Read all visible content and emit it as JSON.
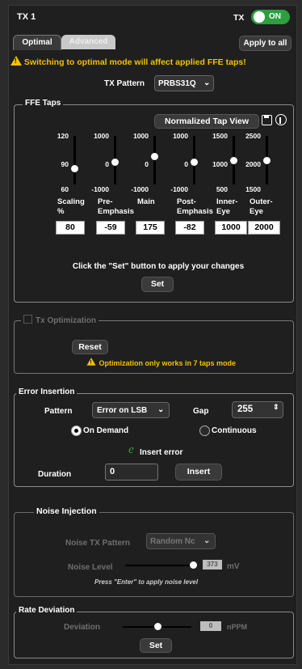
{
  "header": {
    "title": "TX 1",
    "tx_label": "TX",
    "toggle_state": "ON"
  },
  "tabs": [
    {
      "label": "Optimal"
    },
    {
      "label": "Advanced"
    }
  ],
  "apply_all_label": "Apply to all",
  "warning_text": "Switching to optimal mode will affect applied FFE taps!",
  "tx_pattern": {
    "label": "TX Pattern",
    "value": "PRBS31Q"
  },
  "ffe": {
    "legend": "FFE Taps",
    "normalized_button": "Normalized Tap View",
    "taps": [
      {
        "ticks": [
          "120",
          "90",
          "60"
        ],
        "name1": "Scaling",
        "name2": "%",
        "value": "80",
        "level": 0.33
      },
      {
        "ticks": [
          "1000",
          "0",
          "-1000"
        ],
        "name1": "Pre-",
        "name2": "Emphasis",
        "value": "-59",
        "level": 0.47
      },
      {
        "ticks": [
          "1000",
          "0",
          "-1000"
        ],
        "name1": "Main",
        "name2": "",
        "value": "175",
        "level": 0.59
      },
      {
        "ticks": [
          "1000",
          "0",
          "-1000"
        ],
        "name1": "Post-",
        "name2": "Emphasis",
        "value": "-82",
        "level": 0.46
      },
      {
        "ticks": [
          "1500",
          "1000",
          "500"
        ],
        "name1": "Inner-",
        "name2": "Eye",
        "value": "1000",
        "level": 0.5
      },
      {
        "ticks": [
          "2500",
          "2000",
          "1500"
        ],
        "name1": "Outer-",
        "name2": "Eye",
        "value": "2000",
        "level": 0.5
      }
    ],
    "instruction": "Click the \"Set\" button to apply your changes",
    "set_label": "Set"
  },
  "tx_opt": {
    "legend": "Tx Optimization",
    "reset_label": "Reset",
    "note": "Optimization only works in 7 taps mode"
  },
  "error": {
    "legend": "Error Insertion",
    "pattern_label": "Pattern",
    "pattern_value": "Error on LSB",
    "gap_label": "Gap",
    "gap_value": "255",
    "on_demand": "On Demand",
    "continuous": "Continuous",
    "insert_error_label": "Insert error",
    "duration_label": "Duration",
    "duration_value": "0",
    "insert_label": "Insert"
  },
  "noise": {
    "legend": "Noise Injection",
    "pattern_label": "Noise TX Pattern",
    "pattern_value": "Random Nc",
    "level_label": "Noise Level",
    "level_value": "373",
    "level_unit": "mV",
    "note": "Press \"Enter\" to apply noise level",
    "level_fraction": 0.95
  },
  "rate": {
    "legend": "Rate Deviation",
    "deviation_label": "Deviation",
    "deviation_value": "0",
    "unit": "nPPM",
    "set_label": "Set",
    "level_fraction": 0.5
  },
  "colors": {
    "accent_green": "#2e9e3e",
    "warning_yellow": "#f2c200",
    "panel_bg": "#1f1f1f"
  }
}
